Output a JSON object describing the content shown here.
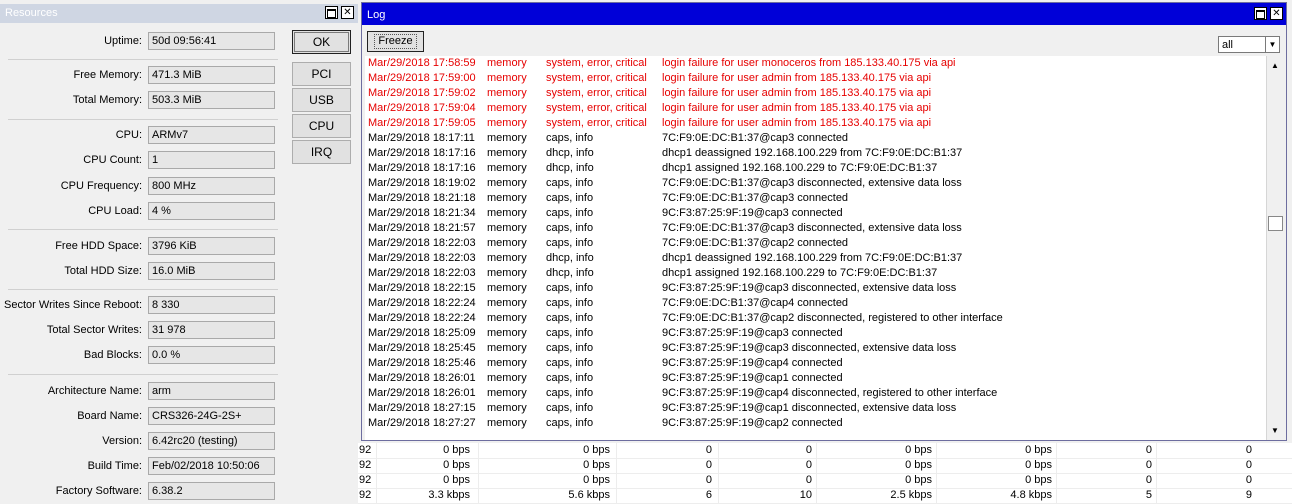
{
  "resources": {
    "title": "Resources",
    "fields": [
      {
        "label": "Uptime:",
        "value": "50d 09:56:41"
      },
      {
        "label": "Free Memory:",
        "value": "471.3 MiB"
      },
      {
        "label": "Total Memory:",
        "value": "503.3 MiB"
      },
      {
        "label": "CPU:",
        "value": "ARMv7"
      },
      {
        "label": "CPU Count:",
        "value": "1"
      },
      {
        "label": "CPU Frequency:",
        "value": "800 MHz"
      },
      {
        "label": "CPU Load:",
        "value": "4 %"
      },
      {
        "label": "Free HDD Space:",
        "value": "3796 KiB"
      },
      {
        "label": "Total HDD Size:",
        "value": "16.0 MiB"
      },
      {
        "label": "Sector Writes Since Reboot:",
        "value": "8 330"
      },
      {
        "label": "Total Sector Writes:",
        "value": "31 978"
      },
      {
        "label": "Bad Blocks:",
        "value": "0.0 %"
      },
      {
        "label": "Architecture Name:",
        "value": "arm"
      },
      {
        "label": "Board Name:",
        "value": "CRS326-24G-2S+"
      },
      {
        "label": "Version:",
        "value": "6.42rc20 (testing)"
      },
      {
        "label": "Build Time:",
        "value": "Feb/02/2018 10:50:06"
      },
      {
        "label": "Factory Software:",
        "value": "6.38.2"
      }
    ],
    "buttons": {
      "ok": "OK",
      "pci": "PCI",
      "usb": "USB",
      "cpu": "CPU",
      "irq": "IRQ"
    }
  },
  "log": {
    "title": "Log",
    "freeze_label": "Freeze",
    "filter_value": "all",
    "entries": [
      {
        "time": "Mar/29/2018 17:58:59",
        "buffer": "memory",
        "topics": "system, error, critical",
        "message": "login failure for user monoceros from 185.133.40.175 via api",
        "level": "error"
      },
      {
        "time": "Mar/29/2018 17:59:00",
        "buffer": "memory",
        "topics": "system, error, critical",
        "message": "login failure for user admin from 185.133.40.175 via api",
        "level": "error"
      },
      {
        "time": "Mar/29/2018 17:59:02",
        "buffer": "memory",
        "topics": "system, error, critical",
        "message": "login failure for user admin from 185.133.40.175 via api",
        "level": "error"
      },
      {
        "time": "Mar/29/2018 17:59:04",
        "buffer": "memory",
        "topics": "system, error, critical",
        "message": "login failure for user admin from 185.133.40.175 via api",
        "level": "error"
      },
      {
        "time": "Mar/29/2018 17:59:05",
        "buffer": "memory",
        "topics": "system, error, critical",
        "message": "login failure for user admin from 185.133.40.175 via api",
        "level": "error"
      },
      {
        "time": "Mar/29/2018 18:17:11",
        "buffer": "memory",
        "topics": "caps, info",
        "message": "7C:F9:0E:DC:B1:37@cap3 connected",
        "level": "info"
      },
      {
        "time": "Mar/29/2018 18:17:16",
        "buffer": "memory",
        "topics": "dhcp, info",
        "message": "dhcp1 deassigned 192.168.100.229 from 7C:F9:0E:DC:B1:37",
        "level": "info"
      },
      {
        "time": "Mar/29/2018 18:17:16",
        "buffer": "memory",
        "topics": "dhcp, info",
        "message": "dhcp1 assigned 192.168.100.229 to 7C:F9:0E:DC:B1:37",
        "level": "info"
      },
      {
        "time": "Mar/29/2018 18:19:02",
        "buffer": "memory",
        "topics": "caps, info",
        "message": "7C:F9:0E:DC:B1:37@cap3 disconnected, extensive data loss",
        "level": "info"
      },
      {
        "time": "Mar/29/2018 18:21:18",
        "buffer": "memory",
        "topics": "caps, info",
        "message": "7C:F9:0E:DC:B1:37@cap3 connected",
        "level": "info"
      },
      {
        "time": "Mar/29/2018 18:21:34",
        "buffer": "memory",
        "topics": "caps, info",
        "message": "9C:F3:87:25:9F:19@cap3 connected",
        "level": "info"
      },
      {
        "time": "Mar/29/2018 18:21:57",
        "buffer": "memory",
        "topics": "caps, info",
        "message": "7C:F9:0E:DC:B1:37@cap3 disconnected, extensive data loss",
        "level": "info"
      },
      {
        "time": "Mar/29/2018 18:22:03",
        "buffer": "memory",
        "topics": "caps, info",
        "message": "7C:F9:0E:DC:B1:37@cap2 connected",
        "level": "info"
      },
      {
        "time": "Mar/29/2018 18:22:03",
        "buffer": "memory",
        "topics": "dhcp, info",
        "message": "dhcp1 deassigned 192.168.100.229 from 7C:F9:0E:DC:B1:37",
        "level": "info"
      },
      {
        "time": "Mar/29/2018 18:22:03",
        "buffer": "memory",
        "topics": "dhcp, info",
        "message": "dhcp1 assigned 192.168.100.229 to 7C:F9:0E:DC:B1:37",
        "level": "info"
      },
      {
        "time": "Mar/29/2018 18:22:15",
        "buffer": "memory",
        "topics": "caps, info",
        "message": "9C:F3:87:25:9F:19@cap3 disconnected, extensive data loss",
        "level": "info"
      },
      {
        "time": "Mar/29/2018 18:22:24",
        "buffer": "memory",
        "topics": "caps, info",
        "message": "7C:F9:0E:DC:B1:37@cap4 connected",
        "level": "info"
      },
      {
        "time": "Mar/29/2018 18:22:24",
        "buffer": "memory",
        "topics": "caps, info",
        "message": "7C:F9:0E:DC:B1:37@cap2 disconnected, registered to other interface",
        "level": "info"
      },
      {
        "time": "Mar/29/2018 18:25:09",
        "buffer": "memory",
        "topics": "caps, info",
        "message": "9C:F3:87:25:9F:19@cap3 connected",
        "level": "info"
      },
      {
        "time": "Mar/29/2018 18:25:45",
        "buffer": "memory",
        "topics": "caps, info",
        "message": "9C:F3:87:25:9F:19@cap3 disconnected, extensive data loss",
        "level": "info"
      },
      {
        "time": "Mar/29/2018 18:25:46",
        "buffer": "memory",
        "topics": "caps, info",
        "message": "9C:F3:87:25:9F:19@cap4 connected",
        "level": "info"
      },
      {
        "time": "Mar/29/2018 18:26:01",
        "buffer": "memory",
        "topics": "caps, info",
        "message": "9C:F3:87:25:9F:19@cap1 connected",
        "level": "info"
      },
      {
        "time": "Mar/29/2018 18:26:01",
        "buffer": "memory",
        "topics": "caps, info",
        "message": "9C:F3:87:25:9F:19@cap4 disconnected, registered to other interface",
        "level": "info"
      },
      {
        "time": "Mar/29/2018 18:27:15",
        "buffer": "memory",
        "topics": "caps, info",
        "message": "9C:F3:87:25:9F:19@cap1 disconnected, extensive data loss",
        "level": "info"
      },
      {
        "time": "Mar/29/2018 18:27:27",
        "buffer": "memory",
        "topics": "caps, info",
        "message": "9C:F3:87:25:9F:19@cap2 connected",
        "level": "info"
      }
    ]
  },
  "traffic_rows": [
    {
      "first": "92",
      "cells": [
        "0 bps",
        "0 bps",
        "0",
        "0",
        "0 bps",
        "0 bps",
        "0",
        "0"
      ]
    },
    {
      "first": "92",
      "cells": [
        "0 bps",
        "0 bps",
        "0",
        "0",
        "0 bps",
        "0 bps",
        "0",
        "0"
      ]
    },
    {
      "first": "92",
      "cells": [
        "0 bps",
        "0 bps",
        "0",
        "0",
        "0 bps",
        "0 bps",
        "0",
        "0"
      ]
    },
    {
      "first": "92",
      "cells": [
        "3.3 kbps",
        "5.6 kbps",
        "6",
        "10",
        "2.5 kbps",
        "4.8 kbps",
        "5",
        "9"
      ]
    }
  ],
  "colors": {
    "log_titlebar": "#0000d8",
    "error_text": "#e60000"
  }
}
